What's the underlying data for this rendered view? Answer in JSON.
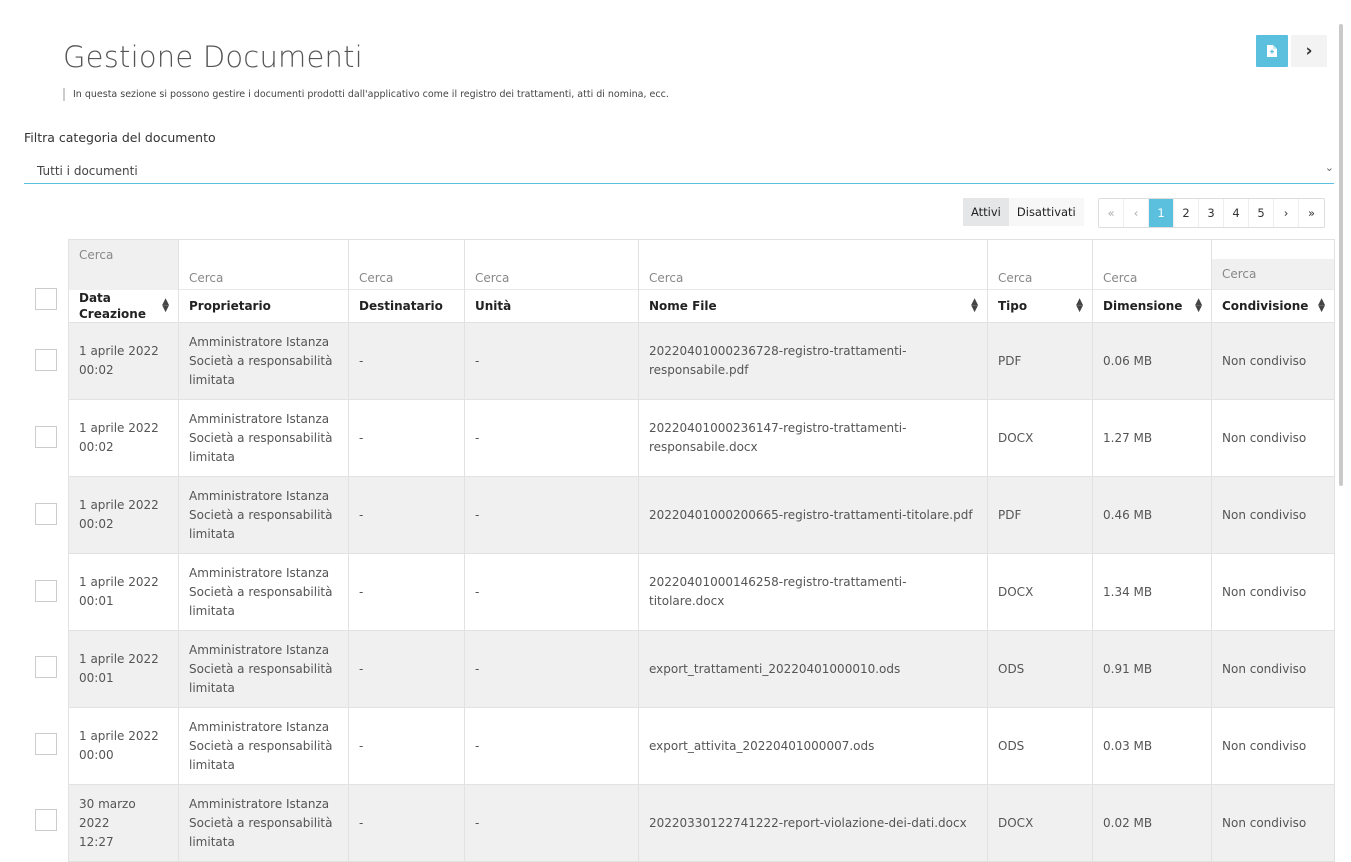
{
  "header": {
    "title": "Gestione Documenti",
    "description": "In questa sezione si possono gestire i documenti prodotti dall'applicativo come il registro dei trattamenti, atti di nomina, ecc.",
    "accent_color": "#5bc0de"
  },
  "filter": {
    "label": "Filtra categoria del documento",
    "selected": "Tutti i documenti"
  },
  "state_toggle": {
    "active_label": "Attivi",
    "inactive_label": "Disattivati"
  },
  "pagination": {
    "first": "«",
    "prev": "‹",
    "pages": [
      "1",
      "2",
      "3",
      "4",
      "5"
    ],
    "current": "1",
    "next": "›",
    "last": "»"
  },
  "table": {
    "search_placeholder": "Cerca",
    "columns": [
      "Data Creazione",
      "Proprietario",
      "Destinatario",
      "Unità",
      "Nome File",
      "Tipo",
      "Dimensione",
      "Condivisione"
    ],
    "rows": [
      {
        "date": "1 aprile 2022",
        "time": "00:02",
        "owner": "Amministratore Istanza Società a responsabilità limitata",
        "recipient": "-",
        "unit": "-",
        "file": "20220401000236728-registro-trattamenti-responsabile.pdf",
        "type": "PDF",
        "size": "0.06 MB",
        "sharing": "Non condiviso"
      },
      {
        "date": "1 aprile 2022",
        "time": "00:02",
        "owner": "Amministratore Istanza Società a responsabilità limitata",
        "recipient": "-",
        "unit": "-",
        "file": "20220401000236147-registro-trattamenti-responsabile.docx",
        "type": "DOCX",
        "size": "1.27 MB",
        "sharing": "Non condiviso"
      },
      {
        "date": "1 aprile 2022",
        "time": "00:02",
        "owner": "Amministratore Istanza Società a responsabilità limitata",
        "recipient": "-",
        "unit": "-",
        "file": "20220401000200665-registro-trattamenti-titolare.pdf",
        "type": "PDF",
        "size": "0.46 MB",
        "sharing": "Non condiviso"
      },
      {
        "date": "1 aprile 2022",
        "time": "00:01",
        "owner": "Amministratore Istanza Società a responsabilità limitata",
        "recipient": "-",
        "unit": "-",
        "file": "20220401000146258-registro-trattamenti-titolare.docx",
        "type": "DOCX",
        "size": "1.34 MB",
        "sharing": "Non condiviso"
      },
      {
        "date": "1 aprile 2022",
        "time": "00:01",
        "owner": "Amministratore Istanza Società a responsabilità limitata",
        "recipient": "-",
        "unit": "-",
        "file": "export_trattamenti_20220401000010.ods",
        "type": "ODS",
        "size": "0.91 MB",
        "sharing": "Non condiviso"
      },
      {
        "date": "1 aprile 2022",
        "time": "00:00",
        "owner": "Amministratore Istanza Società a responsabilità limitata",
        "recipient": "-",
        "unit": "-",
        "file": "export_attivita_20220401000007.ods",
        "type": "ODS",
        "size": "0.03 MB",
        "sharing": "Non condiviso"
      },
      {
        "date": "30 marzo 2022",
        "time": "12:27",
        "owner": "Amministratore Istanza Società a responsabilità limitata",
        "recipient": "-",
        "unit": "-",
        "file": "20220330122741222-report-violazione-dei-dati.docx",
        "type": "DOCX",
        "size": "0.02 MB",
        "sharing": "Non condiviso"
      }
    ]
  }
}
